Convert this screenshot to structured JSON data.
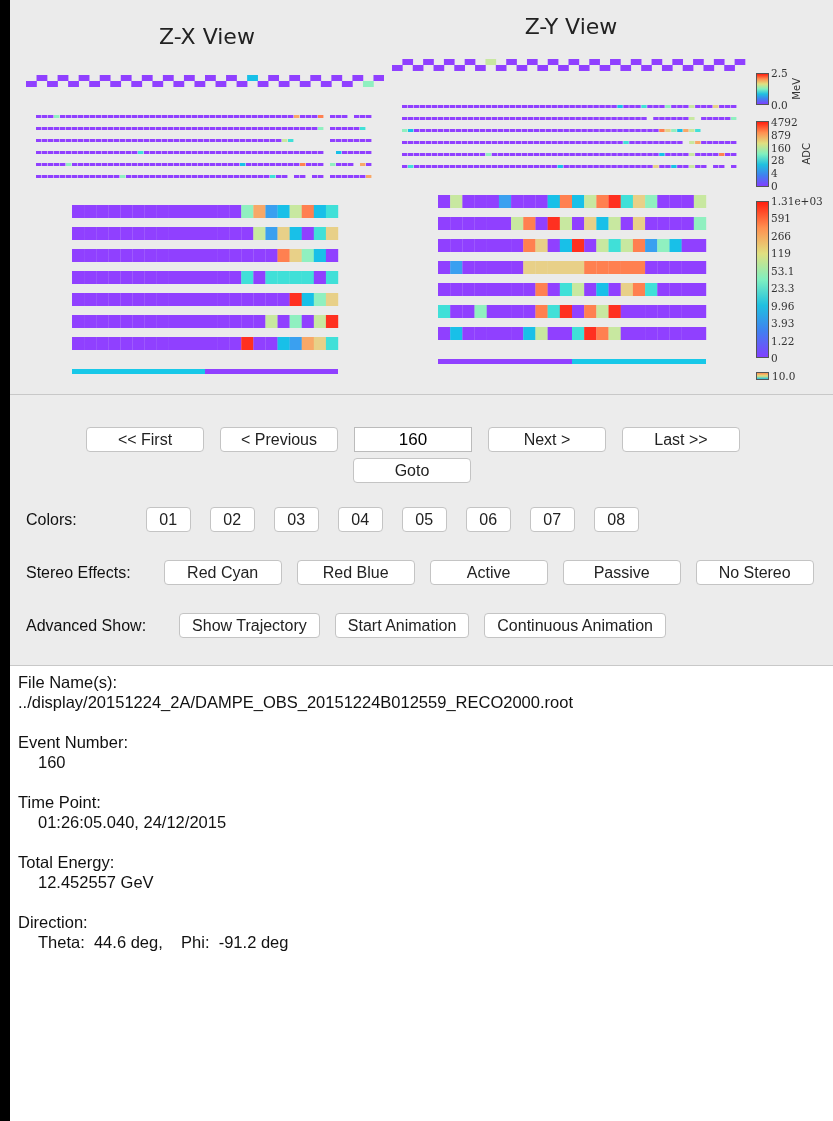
{
  "views": [
    {
      "title": "Z-X View"
    },
    {
      "title": "Z-Y View"
    }
  ],
  "colorbars": [
    {
      "unit": "MeV",
      "ticks": [
        "2.5",
        "0.0"
      ]
    },
    {
      "unit": "ADC",
      "ticks": [
        "4792",
        "879",
        "160",
        "28",
        "4",
        "0"
      ]
    },
    {
      "ticks": [
        "1.31e+03",
        "591",
        "266",
        "119",
        "53.1",
        "23.3",
        "9.96",
        "3.93",
        "1.22",
        "0"
      ]
    }
  ],
  "legend_value": "10.0",
  "navigation": {
    "buttons": [
      "<< First",
      "< Previous",
      "Next >",
      "Last >>"
    ],
    "event_field": {
      "value": "160"
    },
    "goto": "Goto"
  },
  "colors": {
    "label": "Colors:",
    "buttons": [
      "01",
      "02",
      "03",
      "04",
      "05",
      "06",
      "07",
      "08"
    ]
  },
  "stereo": {
    "label": "Stereo Effects:",
    "buttons": [
      "Red Cyan",
      "Red Blue",
      "Active",
      "Passive",
      "No Stereo"
    ]
  },
  "advanced": {
    "label": "Advanced Show:",
    "buttons": [
      "Show Trajectory",
      "Start Animation",
      "Continuous Animation"
    ]
  },
  "info": [
    {
      "label": "File Name(s):",
      "value": "../display/20151224_2A/DAMPE_OBS_20151224B012559_RECO2000.root",
      "indent": false
    },
    {
      "label": "Event Number:",
      "value": "160",
      "indent": true
    },
    {
      "label": "Time Point:",
      "value": "01:26:05.040, 24/12/2015",
      "indent": true
    },
    {
      "label": "Total Energy:",
      "value": "12.452557 GeV",
      "indent": true
    },
    {
      "label": "Direction:",
      "value": "Theta:  44.6 deg,    Phi:  -91.2 deg",
      "indent": true
    }
  ]
}
